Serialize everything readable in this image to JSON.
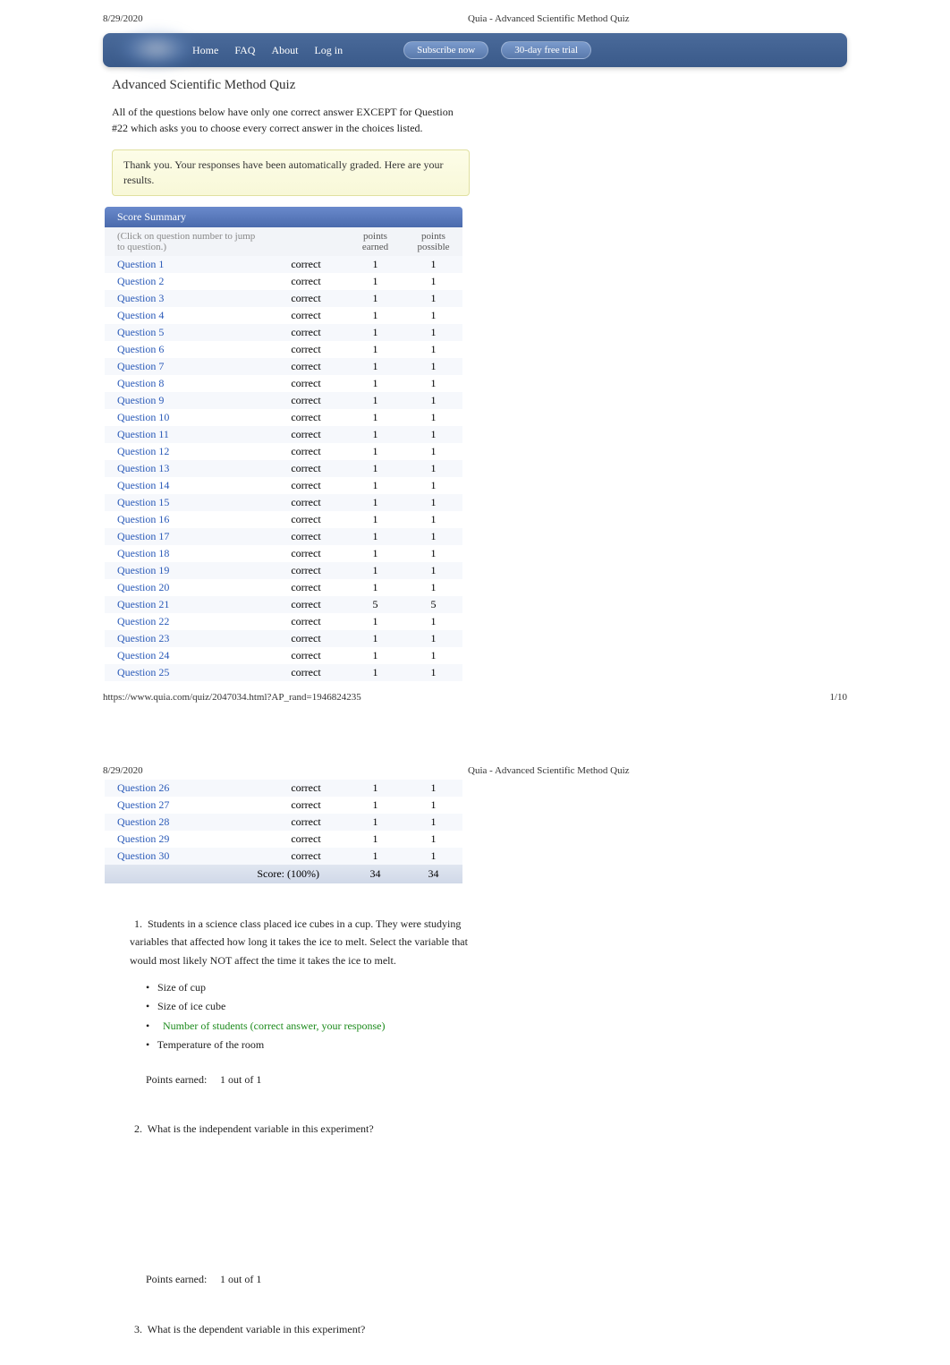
{
  "meta": {
    "date": "8/29/2020",
    "doc_title": "Quia - Advanced Scientific Method Quiz",
    "url": "https://www.quia.com/quiz/2047034.html?AP_rand=1946824235",
    "page_num": "1/10"
  },
  "nav": {
    "home": "Home",
    "faq": "FAQ",
    "about": "About",
    "login": "Log in",
    "subscribe": "Subscribe now",
    "trial": "30-day free trial"
  },
  "quiz": {
    "title": "Advanced Scientific Method Quiz",
    "instructions": "All of the questions below have only one correct answer EXCEPT for Question #22 which asks you to choose every correct answer in the choices listed.",
    "thank_you": "Thank you. Your responses have been automatically graded. Here are your results."
  },
  "summary": {
    "header": "Score Summary",
    "hint": "(Click on question number to jump to question.)",
    "col_earned": "points earned",
    "col_possible": "points possible",
    "score_label": "Score: (100%)",
    "total_earned": "34",
    "total_possible": "34",
    "rows1": [
      {
        "q": "Question 1",
        "status": "correct",
        "earned": "1",
        "possible": "1"
      },
      {
        "q": "Question 2",
        "status": "correct",
        "earned": "1",
        "possible": "1"
      },
      {
        "q": "Question 3",
        "status": "correct",
        "earned": "1",
        "possible": "1"
      },
      {
        "q": "Question 4",
        "status": "correct",
        "earned": "1",
        "possible": "1"
      },
      {
        "q": "Question 5",
        "status": "correct",
        "earned": "1",
        "possible": "1"
      },
      {
        "q": "Question 6",
        "status": "correct",
        "earned": "1",
        "possible": "1"
      },
      {
        "q": "Question 7",
        "status": "correct",
        "earned": "1",
        "possible": "1"
      },
      {
        "q": "Question 8",
        "status": "correct",
        "earned": "1",
        "possible": "1"
      },
      {
        "q": "Question 9",
        "status": "correct",
        "earned": "1",
        "possible": "1"
      },
      {
        "q": "Question 10",
        "status": "correct",
        "earned": "1",
        "possible": "1"
      },
      {
        "q": "Question 11",
        "status": "correct",
        "earned": "1",
        "possible": "1"
      },
      {
        "q": "Question 12",
        "status": "correct",
        "earned": "1",
        "possible": "1"
      },
      {
        "q": "Question 13",
        "status": "correct",
        "earned": "1",
        "possible": "1"
      },
      {
        "q": "Question 14",
        "status": "correct",
        "earned": "1",
        "possible": "1"
      },
      {
        "q": "Question 15",
        "status": "correct",
        "earned": "1",
        "possible": "1"
      },
      {
        "q": "Question 16",
        "status": "correct",
        "earned": "1",
        "possible": "1"
      },
      {
        "q": "Question 17",
        "status": "correct",
        "earned": "1",
        "possible": "1"
      },
      {
        "q": "Question 18",
        "status": "correct",
        "earned": "1",
        "possible": "1"
      },
      {
        "q": "Question 19",
        "status": "correct",
        "earned": "1",
        "possible": "1"
      },
      {
        "q": "Question 20",
        "status": "correct",
        "earned": "1",
        "possible": "1"
      },
      {
        "q": "Question 21",
        "status": "correct",
        "earned": "5",
        "possible": "5"
      },
      {
        "q": "Question 22",
        "status": "correct",
        "earned": "1",
        "possible": "1"
      },
      {
        "q": "Question 23",
        "status": "correct",
        "earned": "1",
        "possible": "1"
      },
      {
        "q": "Question 24",
        "status": "correct",
        "earned": "1",
        "possible": "1"
      },
      {
        "q": "Question 25",
        "status": "correct",
        "earned": "1",
        "possible": "1"
      }
    ],
    "rows2": [
      {
        "q": "Question 26",
        "status": "correct",
        "earned": "1",
        "possible": "1"
      },
      {
        "q": "Question 27",
        "status": "correct",
        "earned": "1",
        "possible": "1"
      },
      {
        "q": "Question 28",
        "status": "correct",
        "earned": "1",
        "possible": "1"
      },
      {
        "q": "Question 29",
        "status": "correct",
        "earned": "1",
        "possible": "1"
      },
      {
        "q": "Question 30",
        "status": "correct",
        "earned": "1",
        "possible": "1"
      }
    ]
  },
  "questions": {
    "q1": {
      "num": "1.",
      "text": "Students in a science class placed ice cubes in a cup. They were studying variables that affected how long it takes the ice to melt. Select the variable that would most likely NOT affect the time it takes the ice to melt.",
      "choices": [
        {
          "text": "Size of cup",
          "correct": false
        },
        {
          "text": "Size of ice cube",
          "correct": false
        },
        {
          "text": "Number of students (correct answer, your response)",
          "correct": true
        },
        {
          "text": "Temperature of the room",
          "correct": false
        }
      ],
      "points_label": "Points earned:",
      "points_value": "1 out of 1"
    },
    "q2": {
      "num": "2.",
      "text": "What is the independent variable in this experiment?",
      "points_label": "Points earned:",
      "points_value": "1 out of 1"
    },
    "q3": {
      "num": "3.",
      "text": "What is the dependent variable in this experiment?"
    }
  }
}
